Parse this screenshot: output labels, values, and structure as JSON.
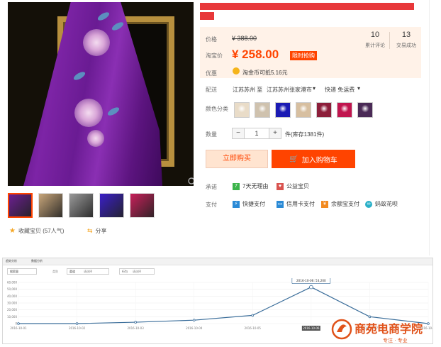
{
  "product": {
    "price_label": "价格",
    "original_price": "¥ 388.00",
    "taobao_price_label": "淘宝价",
    "current_price": "¥ 258.00",
    "promo_badge": "限时抢购",
    "reviews_count": "10",
    "reviews_label": "累计评论",
    "sales_count": "13",
    "sales_label": "交易成功",
    "discount_label": "优惠",
    "discount_text": "淘金币可抵5.16元",
    "delivery_label": "配送",
    "delivery_from": "江苏苏州 至",
    "delivery_to": "江苏苏州张家港市",
    "delivery_method": "快递 免运费",
    "color_label": "颜色分类",
    "swatch_colors": [
      "#e9dcc8",
      "#cfc2ae",
      "#1b1bb4",
      "#d7bfa0",
      "#8c1e3a",
      "#c0154e",
      "#4a2a56"
    ],
    "qty_label": "数量",
    "qty_minus": "−",
    "qty_value": "1",
    "qty_plus": "+",
    "stock_text": "件(库存1381件)",
    "buy_now": "立即购买",
    "add_to_cart": "加入购物车",
    "promise_label": "承诺",
    "promise_1": "7天无理由",
    "promise_2": "公益宝贝",
    "payment_label": "支付",
    "payments": [
      "快捷支付",
      "信用卡支付",
      "余额宝支付",
      "蚂蚁花呗"
    ],
    "collect_text": "收藏宝贝 (57人气)",
    "share_text": "分享",
    "thumb_colors": [
      "#6b1f90",
      "#c8a67a",
      "#9a9a9a",
      "#3a1fc8",
      "#c8205a"
    ]
  },
  "chart_panel": {
    "tab1": "趋势分析",
    "tab2": "数据分析",
    "filter_1": "搜索量",
    "filter_2": "类别",
    "filter_3": "渠道",
    "filter_3_value": "请选择",
    "filter_4": "行为",
    "filter_4_value": "请选择"
  },
  "chart_data": {
    "type": "line",
    "x": [
      "2016-10-01",
      "2016-10-02",
      "2016-10-03",
      "2016-10-04",
      "2016-10-05",
      "2016-10-06",
      "2016-10-07",
      "2016-10-08"
    ],
    "values": [
      0,
      0,
      2000,
      5000,
      12000,
      53200,
      10000,
      0
    ],
    "ylim": [
      0,
      60000
    ],
    "yticks": [
      "60,000",
      "50,000",
      "40,000",
      "30,000",
      "20,000",
      "10,000",
      "0"
    ],
    "tooltip": "2016-10-06: 53,200",
    "highlight_index": 5,
    "line_color": "#3a6d9a"
  },
  "logo": {
    "name": "商苑电商学院",
    "slogan": "专注 · 专业"
  }
}
